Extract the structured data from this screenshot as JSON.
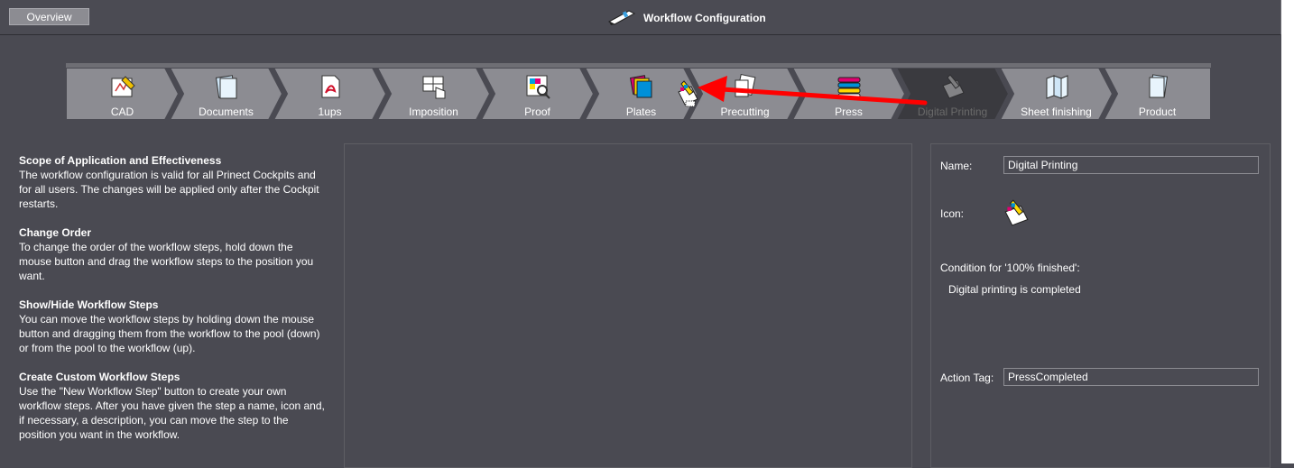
{
  "header": {
    "overview_label": "Overview",
    "title": "Workflow Configuration",
    "title_icon": "workflow-pen-icon"
  },
  "workflow": {
    "steps": [
      {
        "label": "CAD",
        "icon": "cad-icon"
      },
      {
        "label": "Documents",
        "icon": "documents-icon"
      },
      {
        "label": "1ups",
        "icon": "pdf-icon"
      },
      {
        "label": "Imposition",
        "icon": "imposition-icon"
      },
      {
        "label": "Proof",
        "icon": "proof-icon"
      },
      {
        "label": "Plates",
        "icon": "plates-icon"
      },
      {
        "label": "Precutting",
        "icon": "precutting-icon"
      },
      {
        "label": "Press",
        "icon": "press-icon"
      },
      {
        "label": "Digital Printing",
        "icon": "digital-printing-icon"
      },
      {
        "label": "Sheet finishing",
        "icon": "sheet-finishing-icon"
      },
      {
        "label": "Product",
        "icon": "product-icon"
      }
    ],
    "selected_step": "Digital Printing"
  },
  "help": {
    "sections": [
      {
        "heading": "Scope of Application and Effectiveness",
        "text": "The workflow configuration is valid for all Prinect Cockpits and for all users. The changes will be applied only after the Cockpit restarts."
      },
      {
        "heading": "Change Order",
        "text": "To change the order of the workflow steps, hold down the mouse button and drag the workflow steps to the position you want."
      },
      {
        "heading": "Show/Hide Workflow Steps",
        "text": "You can move the workflow steps by holding down the mouse button and dragging them from the workflow to the pool (down) or from the pool to the workflow (up)."
      },
      {
        "heading": "Create Custom Workflow Steps",
        "text": "Use the \"New Workflow Step\" button to create your own workflow steps. After you have given the step a name, icon and, if necessary, a description, you can move the step to the position you want in the workflow."
      }
    ]
  },
  "properties": {
    "name_label": "Name:",
    "name_value": "Digital Printing",
    "icon_label": "Icon:",
    "icon": "digital-printing-icon",
    "condition_label": "Condition for '100% finished':",
    "condition_value": "Digital printing is completed",
    "action_tag_label": "Action Tag:",
    "action_tag_value": "PressCompleted"
  },
  "colors": {
    "background": "#4a4a52",
    "step_fill": "#8c8c92",
    "step_selected_fill": "#3a3a3f",
    "annotation_arrow": "#ff0000"
  }
}
